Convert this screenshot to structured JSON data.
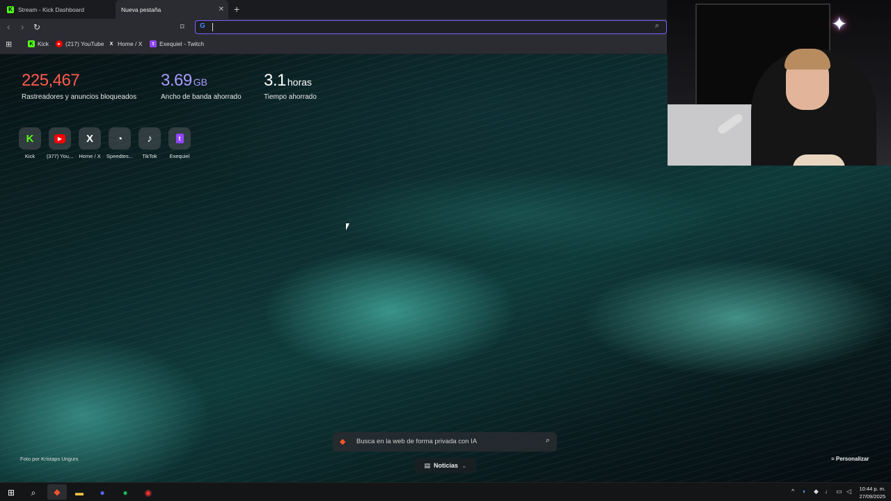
{
  "browser": {
    "tabs": [
      {
        "label": "Stream - Kick Dashboard",
        "icon": "kick-icon"
      },
      {
        "label": "Nueva pestaña",
        "icon": "none"
      }
    ],
    "address_bar": {
      "value": "",
      "engine_icon": "google-icon"
    },
    "bookmarks": [
      {
        "label": "Kick",
        "icon": "kick-icon"
      },
      {
        "label": "(217) YouTube",
        "icon": "youtube-icon"
      },
      {
        "label": "Home / X",
        "icon": "x-icon"
      },
      {
        "label": "Exequiel - Twitch",
        "icon": "twitch-icon"
      }
    ]
  },
  "stats": [
    {
      "value": "225,467",
      "unit": "",
      "label": "Rastreadores y anuncios bloqueados",
      "color": "#ff5a4f"
    },
    {
      "value": "3.69",
      "unit": "GB",
      "label": "Ancho de banda ahorrado",
      "color": "#a89bff"
    },
    {
      "value": "3.1",
      "unit": "horas",
      "label": "Tiempo ahorrado",
      "color": "#ffffff"
    }
  ],
  "shortcuts": [
    {
      "label": "Kick",
      "icon": "kick-icon"
    },
    {
      "label": "(377) You...",
      "icon": "youtube-icon"
    },
    {
      "label": "Home / X",
      "icon": "x-icon"
    },
    {
      "label": "Speedtes...",
      "icon": "speedtest-icon"
    },
    {
      "label": "TikTok",
      "icon": "tiktok-icon"
    },
    {
      "label": "Exequiel",
      "icon": "twitch-icon"
    }
  ],
  "ai_search": {
    "placeholder": "Busca en la web de forma privada con IA"
  },
  "news": {
    "label": "Noticias"
  },
  "photo_credit": "Foto por Kristaps Ungurs",
  "customize": {
    "label": "Personalizar"
  },
  "taskbar": {
    "time": "10:44 p. m.",
    "date": "27/09/2025"
  },
  "colors": {
    "accent": "#7b61ff",
    "kick": "#53fc18",
    "youtube": "#ff0000",
    "twitch": "#9146ff"
  }
}
